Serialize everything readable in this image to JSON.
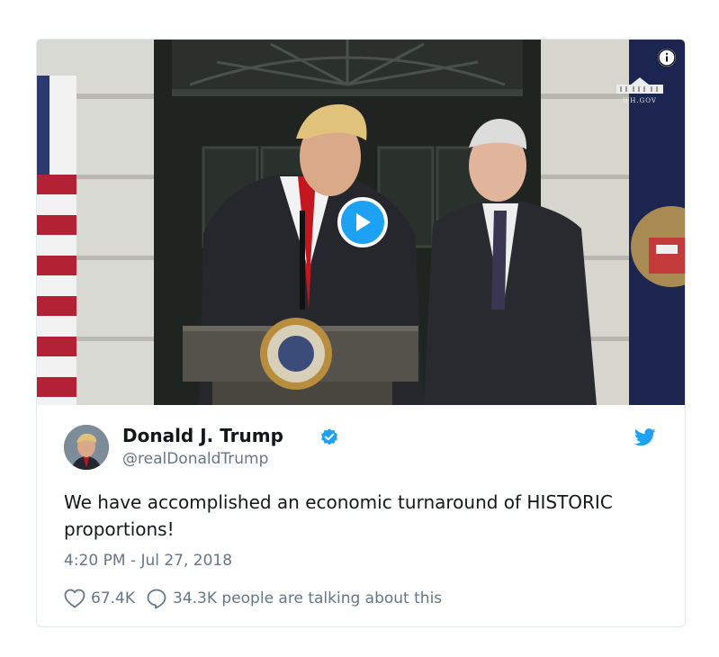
{
  "tweet": {
    "author_name": "Donald J. Trump",
    "author_handle": "@realDonaldTrump",
    "verified": true,
    "text": "We have accomplished an economic turnaround of HISTORIC proportions!",
    "timestamp": "4:20 PM - Jul 27, 2018",
    "likes": "67.4K",
    "conversation": "34.3K people are talking about this"
  },
  "media": {
    "type": "video",
    "watermark": "WH.GOV",
    "play_icon": "play-icon",
    "info_icon": "info-icon"
  },
  "colors": {
    "brand_blue": "#1da1f2",
    "text_primary": "#14171a",
    "text_secondary": "#657786",
    "border": "#e1e8ed"
  }
}
